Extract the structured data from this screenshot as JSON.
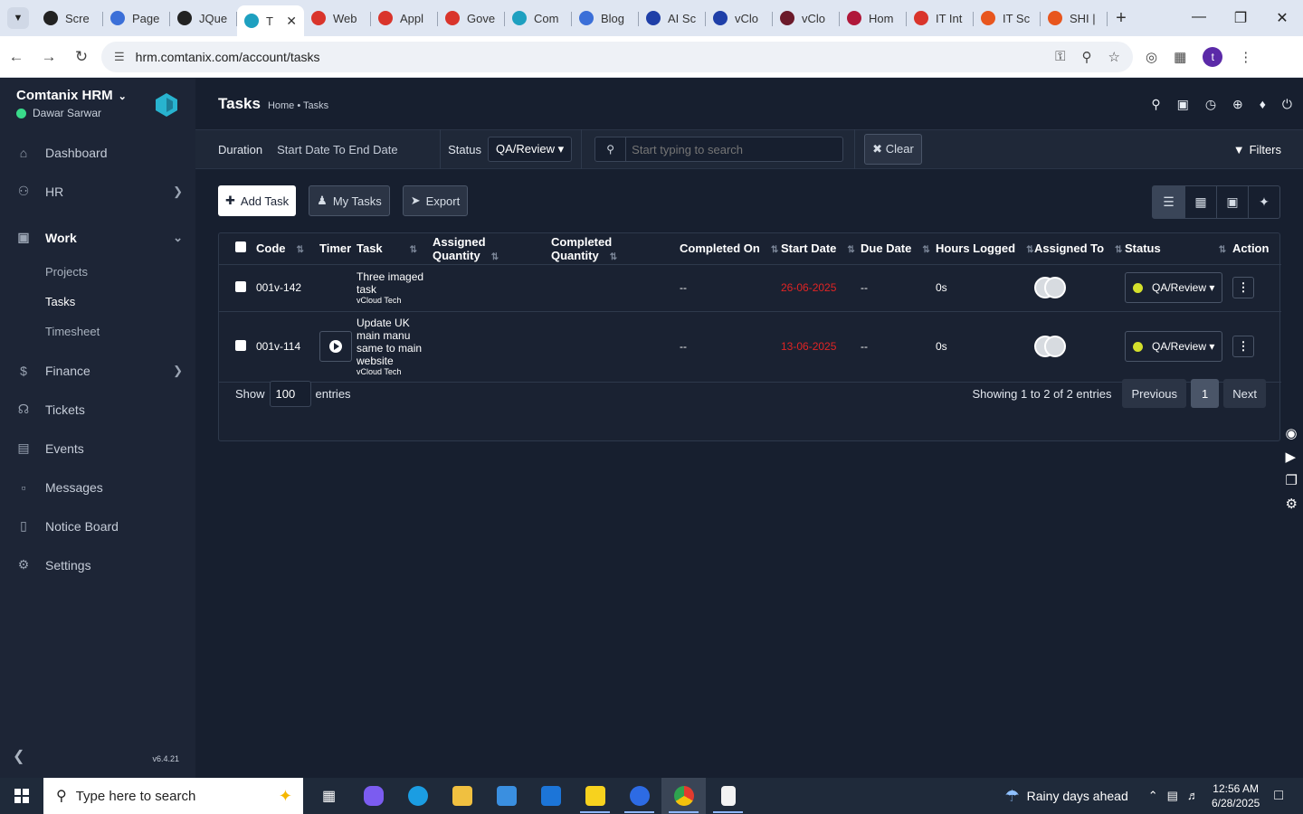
{
  "browser": {
    "tabs": [
      {
        "label": "Scre",
        "color": "#222222"
      },
      {
        "label": "Page",
        "color": "#3b6fd8"
      },
      {
        "label": "JQue",
        "color": "#222222"
      },
      {
        "label": "T",
        "color": "#1ea0c0",
        "active": true
      },
      {
        "label": "Web",
        "color": "#d9342b"
      },
      {
        "label": "Appl",
        "color": "#d9342b"
      },
      {
        "label": "Gove",
        "color": "#d9342b"
      },
      {
        "label": "Com",
        "color": "#1ea0c0"
      },
      {
        "label": "Blog",
        "color": "#3b6fd8"
      },
      {
        "label": "AI Sc",
        "color": "#1f3fa8"
      },
      {
        "label": "vClo",
        "color": "#1f3fa8"
      },
      {
        "label": "vClo",
        "color": "#6b1a2a"
      },
      {
        "label": "Hom",
        "color": "#b0183a"
      },
      {
        "label": "IT Int",
        "color": "#d9342b"
      },
      {
        "label": "IT Sc",
        "color": "#e8561e"
      },
      {
        "label": "SHI |",
        "color": "#e8561e"
      }
    ],
    "url": "hrm.comtanix.com/account/tasks",
    "profile_initial": "t"
  },
  "sidebar": {
    "company": "Comtanix HRM",
    "user": "Dawar Sarwar",
    "items": [
      {
        "label": "Dashboard",
        "icon": "home-icon"
      },
      {
        "label": "HR",
        "icon": "users-icon",
        "chevron": true
      },
      {
        "label": "Work",
        "icon": "briefcase-icon",
        "open": true
      },
      {
        "label": "Finance",
        "icon": "dollar-icon",
        "chevron": true
      },
      {
        "label": "Tickets",
        "icon": "headset-icon"
      },
      {
        "label": "Events",
        "icon": "calendar-icon"
      },
      {
        "label": "Messages",
        "icon": "message-icon"
      },
      {
        "label": "Notice Board",
        "icon": "clipboard-icon"
      },
      {
        "label": "Settings",
        "icon": "gear-icon"
      }
    ],
    "work_sub": [
      "Projects",
      "Tasks",
      "Timesheet"
    ],
    "version": "v6.4.21"
  },
  "page": {
    "title": "Tasks",
    "breadcrumb": "Home • Tasks"
  },
  "filters": {
    "duration_label": "Duration",
    "duration_value": "Start Date To End Date",
    "status_label": "Status",
    "status_value": "QA/Review",
    "search_placeholder": "Start typing to search",
    "clear_label": "Clear",
    "filters_label": "Filters"
  },
  "toolbar": {
    "add_task": "Add Task",
    "my_tasks": "My Tasks",
    "export": "Export"
  },
  "table": {
    "headers": [
      "Code",
      "Timer",
      "Task",
      "Assigned Quantity",
      "Completed Quantity",
      "Completed On",
      "Start Date",
      "Due Date",
      "Hours Logged",
      "Assigned To",
      "Status",
      "Action"
    ],
    "rows": [
      {
        "code": "001v-142",
        "task": "Three imaged task",
        "project": "vCloud Tech",
        "assigned_qty": "",
        "completed_qty": "",
        "completed_on": "--",
        "start_date": "26-06-2025",
        "due_date": "--",
        "hours": "0s",
        "status": "QA/Review",
        "timer": false
      },
      {
        "code": "001v-114",
        "task": "Update UK main manu same to main website",
        "project": "vCloud Tech",
        "assigned_qty": "",
        "completed_qty": "",
        "completed_on": "--",
        "start_date": "13-06-2025",
        "due_date": "--",
        "hours": "0s",
        "status": "QA/Review",
        "timer": true
      }
    ],
    "show_label": "Show",
    "entries_value": "100",
    "entries_label": "entries",
    "info": "Showing 1 to 2 of 2 entries",
    "prev": "Previous",
    "page": "1",
    "next": "Next"
  },
  "taskbar": {
    "search_placeholder": "Type here to search",
    "weather": "Rainy days ahead",
    "time": "12:56 AM",
    "date": "6/28/2025"
  }
}
